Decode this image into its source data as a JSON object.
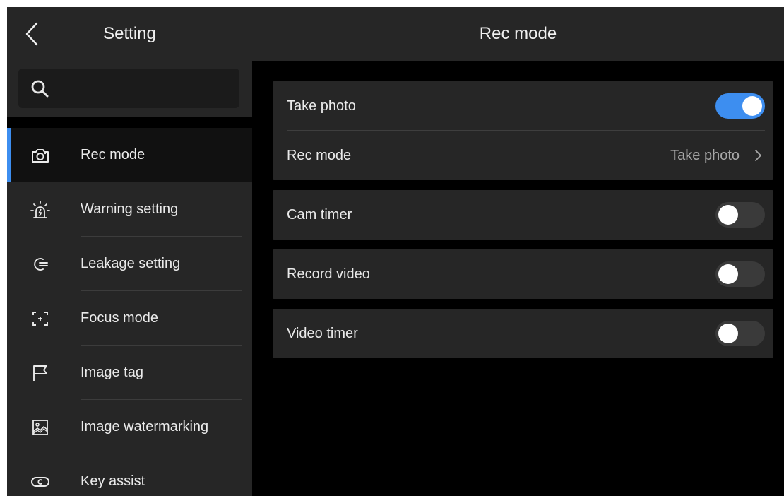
{
  "sidebar": {
    "title": "Setting",
    "search": {
      "placeholder": "",
      "value": ""
    },
    "items": [
      {
        "label": "Rec mode",
        "icon": "camera-icon",
        "active": true
      },
      {
        "label": "Warning setting",
        "icon": "alarm-light-icon",
        "active": false
      },
      {
        "label": "Leakage setting",
        "icon": "leakage-icon",
        "active": false
      },
      {
        "label": "Focus mode",
        "icon": "focus-icon",
        "active": false
      },
      {
        "label": "Image tag",
        "icon": "flag-icon",
        "active": false
      },
      {
        "label": "Image watermarking",
        "icon": "image-icon",
        "active": false
      },
      {
        "label": "Key assist",
        "icon": "key-assist-icon",
        "active": false
      }
    ]
  },
  "main": {
    "title": "Rec mode",
    "groups": [
      {
        "rows": [
          {
            "label": "Take photo",
            "type": "toggle",
            "on": true
          },
          {
            "label": "Rec mode",
            "type": "value",
            "value": "Take photo"
          }
        ]
      },
      {
        "rows": [
          {
            "label": "Cam timer",
            "type": "toggle",
            "on": false
          }
        ]
      },
      {
        "rows": [
          {
            "label": "Record video",
            "type": "toggle",
            "on": false
          }
        ]
      },
      {
        "rows": [
          {
            "label": "Video timer",
            "type": "toggle",
            "on": false
          }
        ]
      }
    ]
  },
  "colors": {
    "accent": "#3d8ef0",
    "panel": "#262626",
    "background": "#000000"
  }
}
